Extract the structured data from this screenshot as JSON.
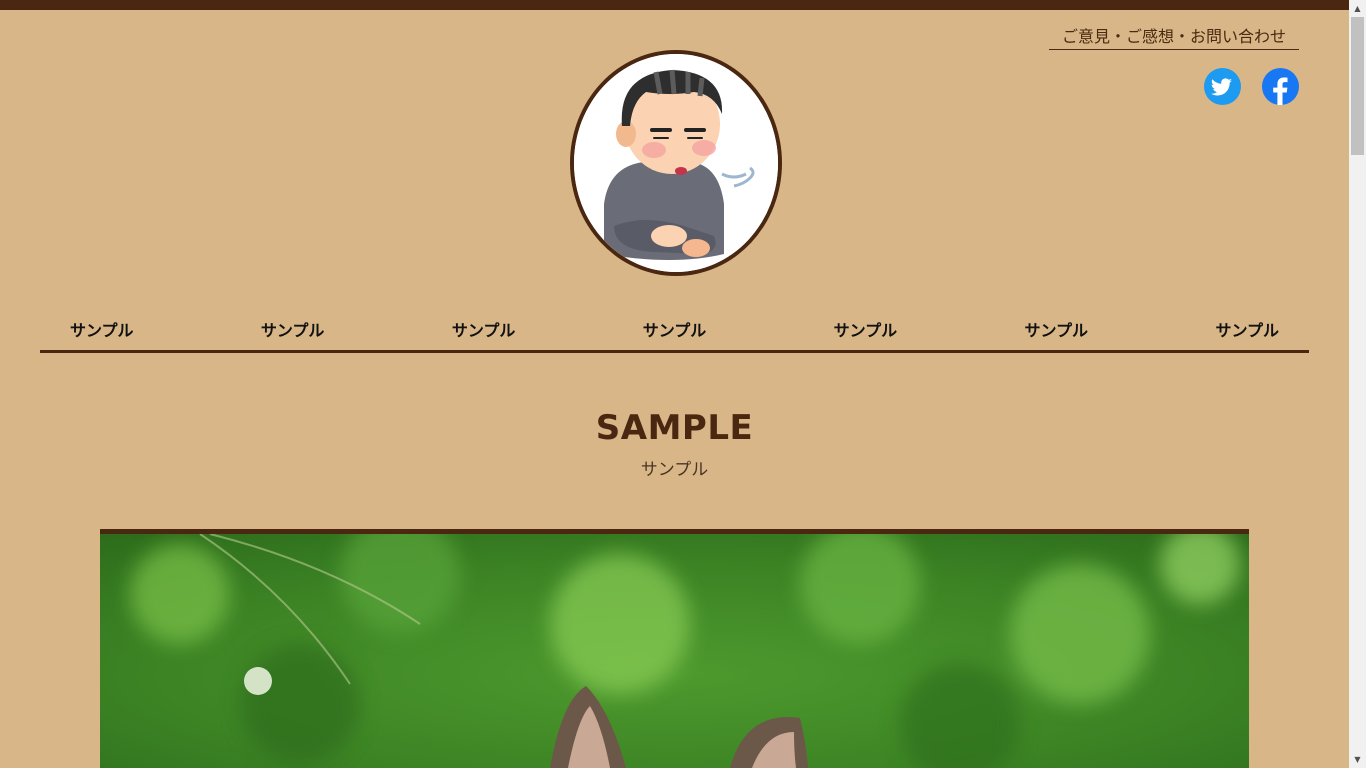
{
  "header": {
    "contact_link": "ご意見・ご感想・お問い合わせ",
    "social": [
      {
        "icon": "twitter-icon",
        "color": "#1d9bf0"
      },
      {
        "icon": "facebook-icon",
        "color": "#1877f2"
      }
    ],
    "avatar_icon": "sighing-boy-illustration"
  },
  "nav": {
    "items": [
      "サンプル",
      "サンプル",
      "サンプル",
      "サンプル",
      "サンプル",
      "サンプル",
      "サンプル"
    ]
  },
  "section": {
    "title": "SAMPLE",
    "subtitle": "サンプル"
  },
  "hero": {
    "image": "cat-in-grass-photo"
  },
  "colors": {
    "background": "#d8b687",
    "accent": "#4a2710"
  }
}
